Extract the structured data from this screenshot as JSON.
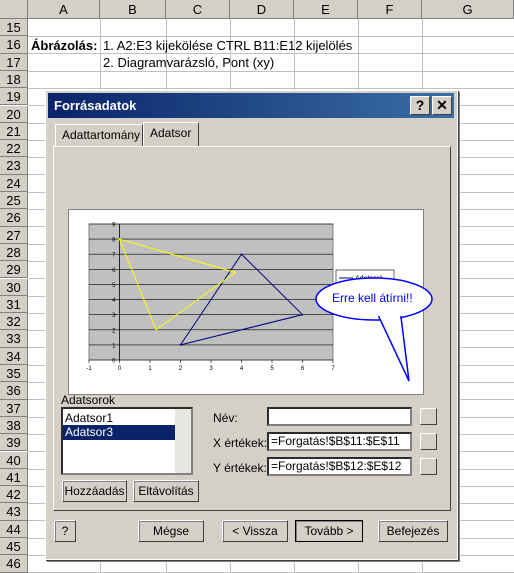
{
  "sheet": {
    "columns": [
      "A",
      "B",
      "C",
      "D",
      "E",
      "F",
      "G"
    ],
    "rows": [
      "15",
      "16",
      "17",
      "18",
      "19",
      "20",
      "21",
      "22",
      "23",
      "24",
      "25",
      "26",
      "27",
      "28",
      "29",
      "30",
      "31",
      "32",
      "33",
      "34",
      "35",
      "36",
      "37",
      "38",
      "39",
      "40",
      "41",
      "42",
      "43",
      "44",
      "45",
      "46"
    ],
    "a16": "Ábrázolás:",
    "b16": "1. A2:E3 kijekölése CTRL B11:E12 kijelölés",
    "b17": "2. Diagramvarázsló, Pont (xy)"
  },
  "dialog": {
    "title": "Forrásadatok",
    "help_btn": "?",
    "close_btn": "✕",
    "tabs": [
      "Adattartomány",
      "Adatsor"
    ],
    "callout": "Erre kell átírni!!",
    "series_group": "Adatsorok",
    "series": [
      "Adatsor1",
      "Adatsor3"
    ],
    "add_btn": "Hozzáadás",
    "remove_btn": "Eltávolítás",
    "name_label": "Név:",
    "name_value": "",
    "x_label": "X értékek:",
    "x_value": "=Forgatás!$B$11:$E$11",
    "y_label": "Y értékek:",
    "y_value": "=Forgatás!$B$12:$E$12",
    "cancel_btn": "Mégse",
    "back_btn": "< Vissza",
    "next_btn": "Tovább >",
    "finish_btn": "Befejezés"
  },
  "chart_data": {
    "type": "scatter",
    "xlim": [
      -1,
      7
    ],
    "ylim": [
      0,
      9
    ],
    "x_ticks": [
      "-1",
      "0",
      "1",
      "2",
      "3",
      "4",
      "5",
      "6",
      "7"
    ],
    "y_ticks": [
      "0",
      "1",
      "2",
      "3",
      "4",
      "5",
      "6",
      "7",
      "8",
      "9"
    ],
    "grid": true,
    "legend": "right",
    "series": [
      {
        "name": "Adatsor1",
        "color": "#000080",
        "points": [
          [
            2,
            1
          ],
          [
            4,
            7
          ],
          [
            6,
            3
          ],
          [
            2,
            1
          ]
        ]
      },
      {
        "name": "Adatsor3",
        "color": "#ffff00",
        "points": [
          [
            0,
            8
          ],
          [
            3.8,
            5.8
          ],
          [
            1.2,
            2
          ],
          [
            0,
            8
          ]
        ]
      }
    ]
  }
}
